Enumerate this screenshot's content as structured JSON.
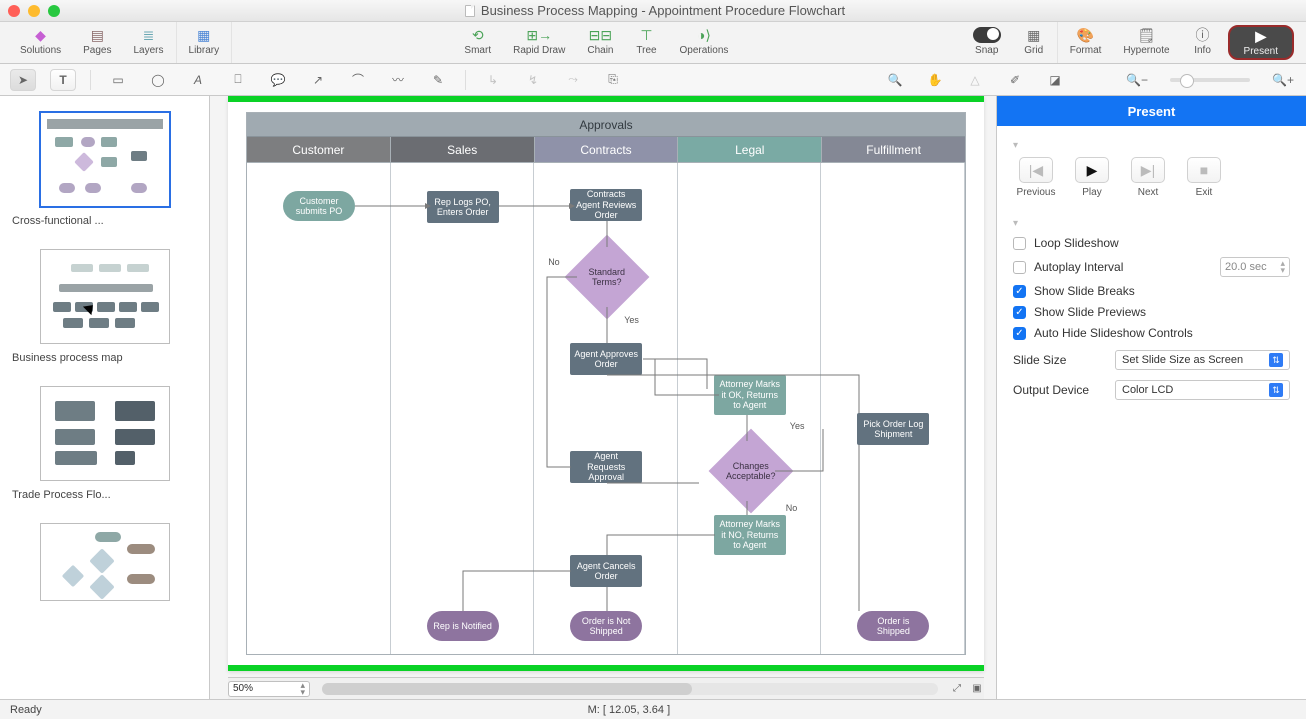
{
  "window_title": "Business Process Mapping - Appointment Procedure Flowchart",
  "toolbar": {
    "solutions": "Solutions",
    "pages": "Pages",
    "layers": "Layers",
    "library": "Library",
    "smart": "Smart",
    "rapid": "Rapid Draw",
    "chain": "Chain",
    "tree": "Tree",
    "operations": "Operations",
    "snap": "Snap",
    "grid": "Grid",
    "format": "Format",
    "hypernote": "Hypernote",
    "info": "Info",
    "present": "Present"
  },
  "thumbs": {
    "t1": "Cross-functional ...",
    "t2": "Business process map",
    "t3": "Trade Process Flo..."
  },
  "swimlane": {
    "title": "Approvals",
    "heads": {
      "c": "Customer",
      "s": "Sales",
      "ct": "Contracts",
      "l": "Legal",
      "f": "Fulfillment"
    }
  },
  "nodes": {
    "start": "Customer submits PO",
    "rep": "Rep Logs PO, Enters Order",
    "review": "Contracts Agent Reviews Order",
    "std": "Standard Terms?",
    "approve": "Agent Approves Order",
    "reqapp": "Agent Requests Approval",
    "cancel": "Agent Cancels Order",
    "atty_ok": "Attorney Marks it OK, Returns to Agent",
    "changes": "Changes Acceptable?",
    "atty_no": "Attorney Marks it NO, Returns to Agent",
    "pick": "Pick Order Log Shipment",
    "notif": "Rep is Notified",
    "notship": "Order is Not Shipped",
    "ship": "Order is Shipped",
    "yes": "Yes",
    "no": "No"
  },
  "canvas": {
    "zoom": "50%"
  },
  "present": {
    "title": "Present",
    "prev": "Previous",
    "play": "Play",
    "next": "Next",
    "exit": "Exit",
    "loop": "Loop Slideshow",
    "autoplay": "Autoplay Interval",
    "interval": "20.0 sec",
    "breaks": "Show Slide Breaks",
    "previews": "Show Slide Previews",
    "autohide": "Auto Hide Slideshow Controls",
    "slidesize_k": "Slide Size",
    "slidesize_v": "Set Slide Size as Screen",
    "output_k": "Output Device",
    "output_v": "Color LCD"
  },
  "status": {
    "ready": "Ready",
    "mouse": "M: [ 12.05, 3.64 ]"
  }
}
